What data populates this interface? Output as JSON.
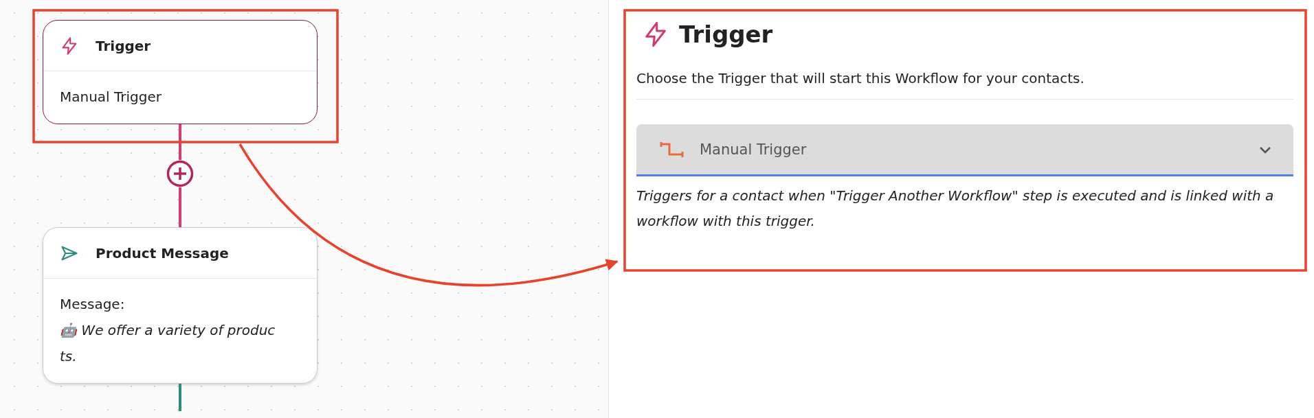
{
  "canvas": {
    "nodes": [
      {
        "kind": "trigger",
        "title": "Trigger",
        "body_lines": [
          "Manual Trigger"
        ],
        "selected": true
      },
      {
        "kind": "message",
        "title": "Product Message",
        "label": "Message:",
        "body_lines": [
          "🤖 We offer a variety of produc",
          "ts."
        ],
        "selected": false
      }
    ]
  },
  "panel": {
    "title": "Trigger",
    "description": "Choose the Trigger that will start this Workflow for your contacts.",
    "trigger_select": {
      "value": "Manual Trigger"
    },
    "help": "Triggers for a contact when \"Trigger Another Workflow\" step is executed and is linked with a workflow with this trigger."
  }
}
